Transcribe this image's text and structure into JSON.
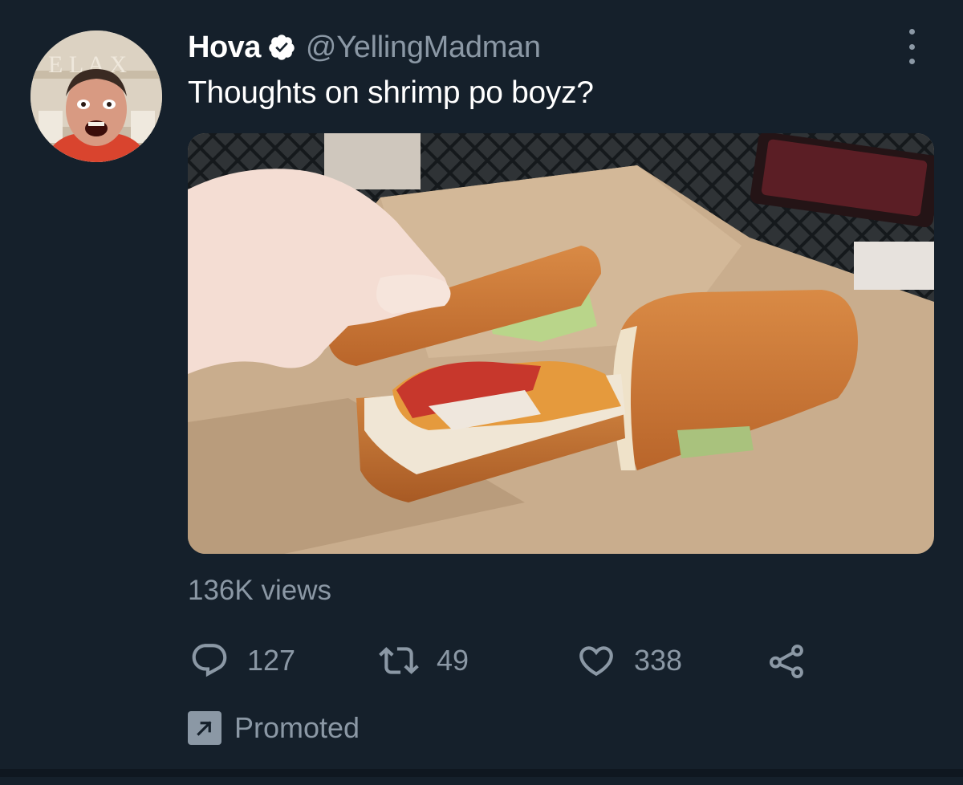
{
  "tweet": {
    "display_name": "Hova",
    "handle": "@YellingMadman",
    "text": "Thoughts on shrimp po boyz?",
    "views": "136K views",
    "promoted_label": "Promoted"
  },
  "actions": {
    "reply": {
      "icon": "reply-icon",
      "count": "127"
    },
    "retweet": {
      "icon": "retweet-icon",
      "count": "49"
    },
    "like": {
      "icon": "heart-icon",
      "count": "338"
    },
    "share": {
      "icon": "share-icon"
    }
  },
  "icons": {
    "verified": "verified-badge-icon",
    "more": "more-vertical-icon",
    "promoted": "promoted-arrow-icon"
  },
  "colors": {
    "background": "#15202b",
    "primary_text": "#ffffff",
    "secondary_text": "#8b98a5"
  }
}
